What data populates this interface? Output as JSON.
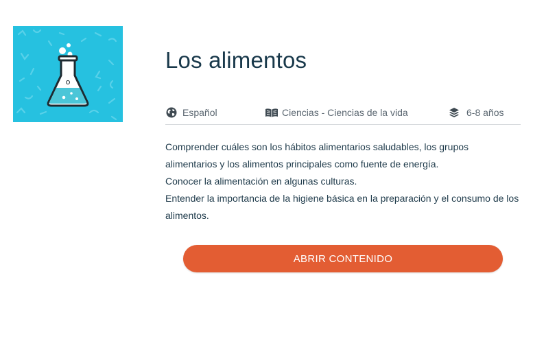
{
  "thumbnail": {
    "icon": "flask-icon",
    "background_color": "#26c1e0"
  },
  "title": "Los alimentos",
  "meta": {
    "language": {
      "icon": "globe-icon",
      "label": "Español"
    },
    "subject": {
      "icon": "book-icon",
      "label": "Ciencias - Ciencias de la vida"
    },
    "age": {
      "icon": "layers-icon",
      "label": "6-8 años"
    }
  },
  "description": [
    "Comprender cuáles son los hábitos alimentarios saludables, los grupos alimentarios y los alimentos principales como fuente de energía.",
    "Conocer la alimentación en algunas culturas.",
    "Entender la importancia de la higiene básica en la preparación y el consumo de los alimentos."
  ],
  "button": {
    "label": "ABRIR CONTENIDO",
    "color": "#e35d33"
  }
}
